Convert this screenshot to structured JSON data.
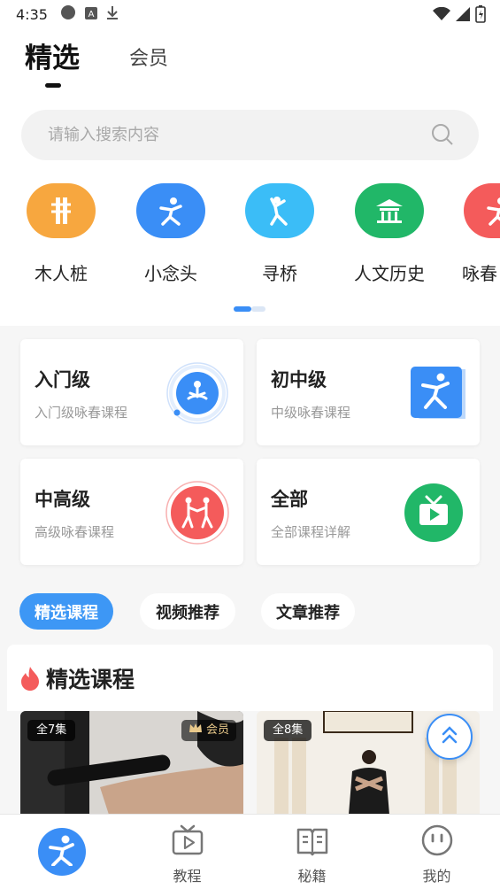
{
  "status_bar": {
    "time": "4:35"
  },
  "top_tabs": {
    "active": "精选",
    "other": "会员"
  },
  "search": {
    "placeholder": "请输入搜索内容"
  },
  "categories": [
    {
      "label": "木人桩",
      "icon": "wooden-dummy-icon",
      "color": "#f7a73f"
    },
    {
      "label": "小念头",
      "icon": "kungfu-figure-icon",
      "color": "#3a8ef6"
    },
    {
      "label": "寻桥",
      "icon": "taichi-figure-icon",
      "color": "#3bbdf7"
    },
    {
      "label": "人文历史",
      "icon": "pavilion-icon",
      "color": "#21b768"
    },
    {
      "label": "咏春",
      "icon": "kungfu-figure-icon",
      "color": "#f45b5b"
    }
  ],
  "levels": [
    {
      "title": "入门级",
      "subtitle": "入门级咏春课程",
      "icon": "meditation-icon",
      "color": "#3a8ef6"
    },
    {
      "title": "初中级",
      "subtitle": "中级咏春课程",
      "icon": "kungfu-figure-icon",
      "color": "#3a8ef6"
    },
    {
      "title": "中高级",
      "subtitle": "高级咏春课程",
      "icon": "sparring-icon",
      "color": "#f45b5b"
    },
    {
      "title": "全部",
      "subtitle": "全部课程详解",
      "icon": "tv-play-icon",
      "color": "#21b768"
    }
  ],
  "filters": [
    {
      "label": "精选课程",
      "active": true
    },
    {
      "label": "视频推荐",
      "active": false
    },
    {
      "label": "文章推荐",
      "active": false
    }
  ],
  "section": {
    "title": "精选课程"
  },
  "courses": [
    {
      "episodes": "全7集",
      "vip": "会员"
    },
    {
      "episodes": "全8集",
      "vip": ""
    }
  ],
  "bottom_nav": [
    {
      "label": "",
      "icon": "kungfu-figure-icon",
      "active": true
    },
    {
      "label": "教程",
      "icon": "tv-play-icon"
    },
    {
      "label": "秘籍",
      "icon": "book-icon"
    },
    {
      "label": "我的",
      "icon": "smiley-icon"
    }
  ],
  "colors": {
    "accent": "#3a8ef6",
    "background": "#f6f6f6"
  }
}
